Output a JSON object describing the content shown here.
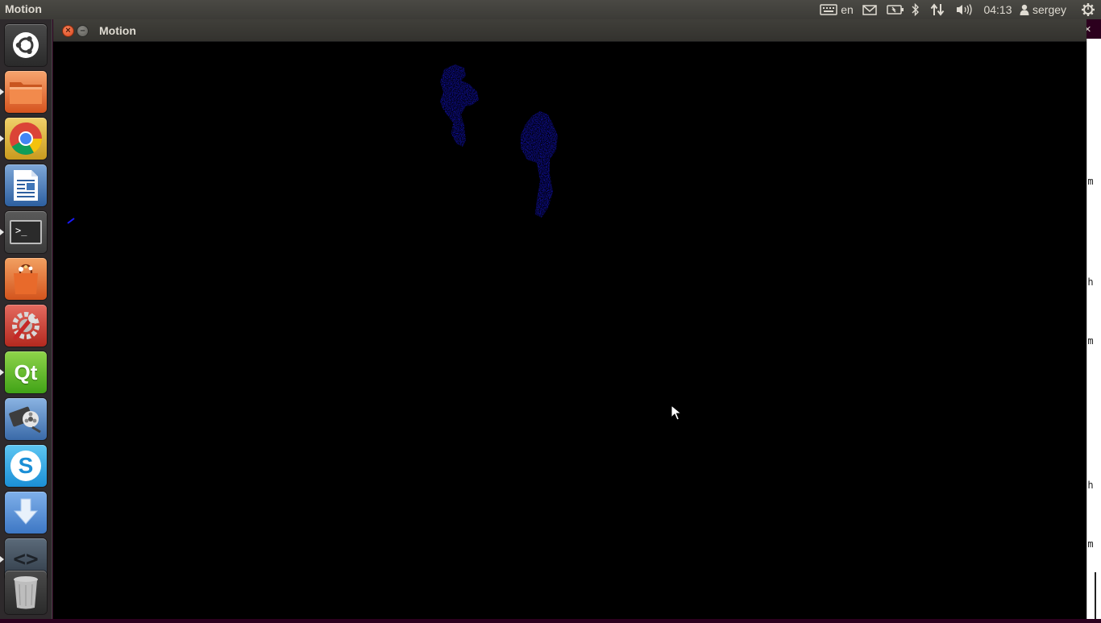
{
  "top_panel": {
    "app_title": "Motion",
    "keyboard_layout": "en",
    "clock": "04:13",
    "user": "sergey",
    "icons": [
      "keyboard-icon",
      "mail-icon",
      "battery-icon",
      "bluetooth-icon",
      "network-icon",
      "volume-icon",
      "user-icon",
      "power-gear-icon"
    ]
  },
  "launcher": {
    "items": [
      {
        "name": "dash-home",
        "icon": "ubuntu-logo-icon",
        "running": false
      },
      {
        "name": "files",
        "icon": "folder-icon",
        "running": true
      },
      {
        "name": "chrome",
        "icon": "chrome-icon",
        "running": true
      },
      {
        "name": "libreoffice-writer",
        "icon": "writer-document-icon",
        "running": false
      },
      {
        "name": "terminal",
        "icon": "terminal-icon",
        "running": true
      },
      {
        "name": "software-center",
        "icon": "shopping-bag-icon",
        "running": false
      },
      {
        "name": "system-settings",
        "icon": "settings-wrench-icon",
        "running": false
      },
      {
        "name": "qt-creator",
        "icon": "qt-icon",
        "running": true
      },
      {
        "name": "video-editor",
        "icon": "film-reel-icon",
        "running": false
      },
      {
        "name": "skype",
        "icon": "skype-icon",
        "running": false
      },
      {
        "name": "downloader",
        "icon": "download-arrow-icon",
        "running": false
      },
      {
        "name": "code-editor",
        "icon": "code-brackets-icon",
        "running": true
      },
      {
        "name": "trash",
        "icon": "trash-icon",
        "running": false
      }
    ],
    "qt_label": "Qt",
    "skype_label": "S",
    "terminal_label": ">_",
    "code_label": "<>"
  },
  "window": {
    "title": "Motion",
    "close_glyph": "×",
    "minimize_glyph": "–"
  },
  "right_strip": {
    "close_glyph": "×",
    "letters": [
      "m",
      "h",
      "m",
      "h",
      "m"
    ]
  },
  "colors": {
    "panel": "#3c3b37",
    "launcher": "#2e2a2c",
    "desktop": "#2c001e",
    "video_bg": "#000000",
    "blob": "#1a1aff"
  }
}
